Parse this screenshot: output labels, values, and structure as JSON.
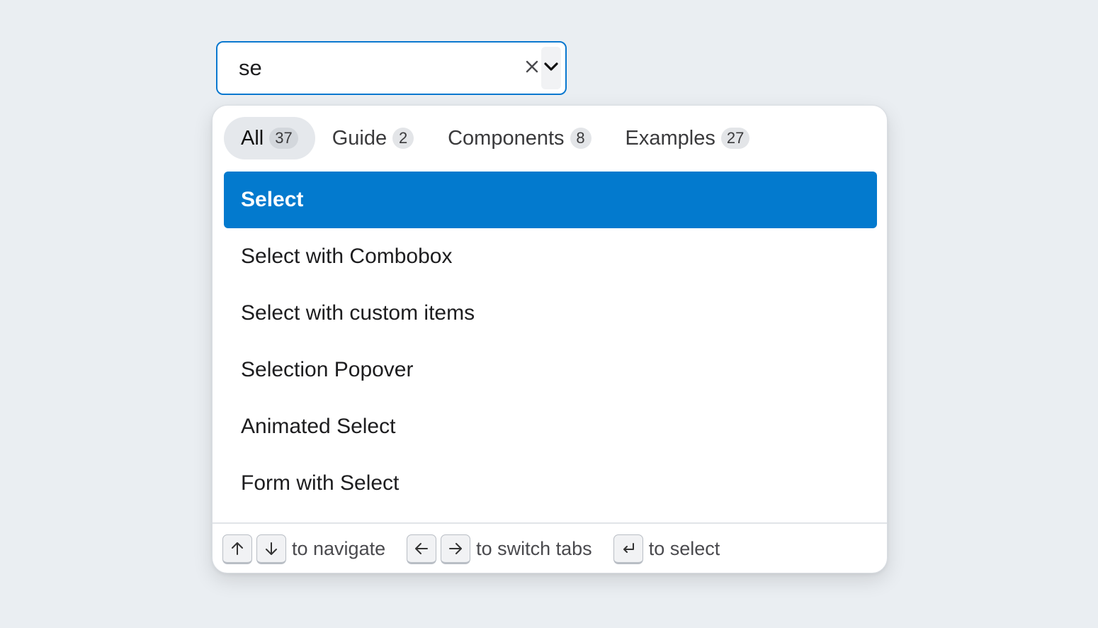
{
  "combobox": {
    "value": "se",
    "clear_icon": "close-icon",
    "toggle_icon": "chevron-down-icon"
  },
  "tabs": [
    {
      "label": "All",
      "count": "37",
      "active": true
    },
    {
      "label": "Guide",
      "count": "2",
      "active": false
    },
    {
      "label": "Components",
      "count": "8",
      "active": false
    },
    {
      "label": "Examples",
      "count": "27",
      "active": false
    }
  ],
  "results": [
    {
      "label": "Select",
      "selected": true
    },
    {
      "label": "Select with Combobox",
      "selected": false
    },
    {
      "label": "Select with custom items",
      "selected": false
    },
    {
      "label": "Selection Popover",
      "selected": false
    },
    {
      "label": "Animated Select",
      "selected": false
    },
    {
      "label": "Form with Select",
      "selected": false
    }
  ],
  "footer": {
    "navigate": {
      "keys": [
        "arrow-up-icon",
        "arrow-down-icon"
      ],
      "text": "to navigate"
    },
    "switch_tabs": {
      "keys": [
        "arrow-left-icon",
        "arrow-right-icon"
      ],
      "text": "to switch tabs"
    },
    "select": {
      "keys": [
        "enter-icon"
      ],
      "text": "to select"
    }
  },
  "colors": {
    "accent": "#037ace",
    "focus_border": "#0a78cf",
    "background": "#eaeef2"
  }
}
